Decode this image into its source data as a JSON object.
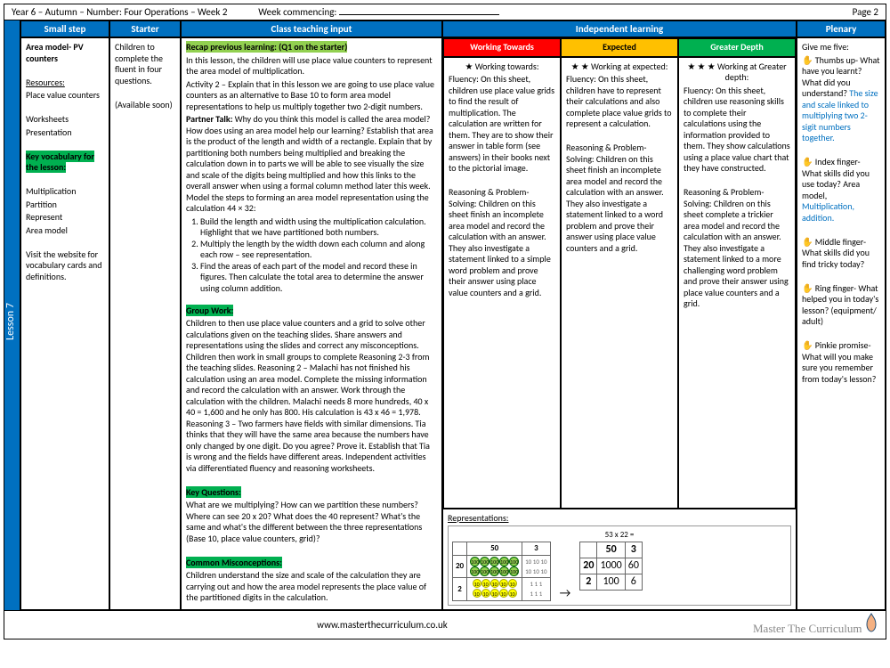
{
  "header": {
    "course": "Year 6 – Autumn – Number: Four Operations – Week 2",
    "week_label": "Week commencing:",
    "page": "Page 2"
  },
  "lesson_tab": "Lesson 7",
  "columns": {
    "smallstep": "Small step",
    "starter": "Starter",
    "teaching": "Class teaching input",
    "independent": "Independent learning",
    "plenary": "Plenary"
  },
  "smallstep": {
    "title": "Area model- PV counters",
    "resources_label": "Resources:",
    "resources": "Place value counters",
    "worksheets": "Worksheets",
    "presentation": "Presentation",
    "vocab_label": "Key vocabulary for the lesson:",
    "vocab1": "Multiplication",
    "vocab2": "Partition",
    "vocab3": "Represent",
    "vocab4": "Area model",
    "website": "Visit the website for vocabulary cards and definitions."
  },
  "starter": {
    "line1": "Children to complete the fluent in four questions.",
    "line2": "(Available soon)"
  },
  "teaching": {
    "recap_label": "Recap previous learning: (Q1 on the starter)",
    "intro": "In this lesson, the children will use place value counters to represent the area model of multiplication.",
    "activity2": "Activity 2 – Explain that in this lesson we are going to use place value counters as an alternative to Base 10 to form area model representations to help us multiply together two 2-digit numbers.",
    "partner_label": "Partner Talk:",
    "partner": "Why do you think this model is called the area model? How does using an area model help our learning? Establish that area is the product of the length and width of a rectangle. Explain that by partitioning both numbers being multiplied and breaking the calculation down in to parts we will be able to see visually the size and scale of the digits being multiplied and how this links to the overall answer when using a formal column method later this week. Model the steps to forming an area model representation using the calculation 44 × 32:",
    "step1": "Build the length and width using the multiplication calculation. Highlight that we have partitioned both numbers.",
    "step2": "Multiply the length by the width down each column and along each row – see representation.",
    "step3": "Find the areas of each part of the model and record these in figures. Then calculate the total area to determine the answer using column addition.",
    "group_label": "Group Work:",
    "group": "Children to then use place value counters and a grid to solve other calculations given on the teaching slides. Share answers and representations using the slides and correct any misconceptions. Children then work in small groups to complete Reasoning 2-3 from the teaching slides. Reasoning 2 – Malachi has not finished his calculation using an area model. Complete the missing information and record the calculation with an answer. Work through the calculation with the children. Malachi needs 8 more hundreds, 40 x 40 = 1,600 and he only has 800. His calculation is 43 x 46 = 1,978. Reasoning 3 – Two farmers have fields with similar dimensions. Tia thinks that they will have the same area because the numbers have only changed by one digit. Do you agree? Prove it. Establish that Tia is wrong and the fields have different areas. Independent activities via differentiated fluency and reasoning worksheets.",
    "keyq_label": "Key Questions:",
    "keyq": "What are we multiplying? How can we partition these numbers? Where can see 20 x 20? What does the 40 represent? What's the same and what's the different between the three representations (Base 10, place value counters, grid)?",
    "misc_label": "Common Misconceptions:",
    "misc": "Children understand the size and scale of the calculation they are carrying out and how the area model represents the place value of the partitioned digits in the calculation."
  },
  "bands": {
    "towards_header": "Working Towards",
    "expected_header": "Expected",
    "greater_header": "Greater Depth",
    "towards_title": "Working towards:",
    "towards_fluency": "Fluency: On this sheet, children use place value grids to find the result of multiplication. The calculation are written for them. They are to show their answer in table form (see answers) in their books next to the pictorial image.",
    "towards_rps": "Reasoning & Problem-Solving: Children on this sheet finish an incomplete area model and record the calculation with an answer. They also investigate a statement linked to a simple word problem and prove their answer using place value counters and a grid.",
    "expected_title": "Working at expected:",
    "expected_fluency": "Fluency: On this sheet, children have to represent their calculations and also complete place value grids to represent a calculation.",
    "expected_rps": "Reasoning & Problem-Solving: Children on this sheet finish an incomplete area model and record the calculation with an answer. They also investigate a statement linked to a word problem and prove their answer using place value counters and a grid.",
    "greater_title": "Working at Greater depth:",
    "greater_fluency": "Fluency: On this sheet, children use reasoning skills to complete their calculations using the information provided to them. They show calculations using a place value chart that they have constructed.",
    "greater_rps": "Reasoning & Problem-Solving: Children on this sheet complete a trickier area model and record the calculation with an answer. They also investigate a statement linked to a more challenging word problem and prove their answer using place value counters and a grid."
  },
  "representations": {
    "label": "Representations:",
    "calc": "53 x 22 =",
    "grid2": {
      "c50_r20": "1000",
      "c3_r20": "60",
      "c50_r2": "100",
      "c3_r2": "6"
    }
  },
  "plenary": {
    "title": "Give me five:",
    "thumbs": "Thumbs up- What have you learnt? What did you understand?",
    "thumbs_ans": "The size and scale linked to multiplying two 2-sigit numbers together.",
    "index": "Index finger- What skills did you use today? Area model,",
    "index_ans": "Multiplication, addition.",
    "middle": "Middle finger- What skills did you find tricky today?",
    "ring": "Ring finger- What helped you in today's lesson? (equipment/ adult)",
    "pinkie": "Pinkie promise- What will you make sure you remember from today's lesson?"
  },
  "footer": {
    "url": "www.masterthecurriculum.co.uk",
    "brand": "Master The Curriculum"
  },
  "chart_data": {
    "type": "table",
    "title": "Area model 53 × 22",
    "rows": [
      "20",
      "2"
    ],
    "columns": [
      "50",
      "3"
    ],
    "values": [
      [
        1000,
        60
      ],
      [
        100,
        6
      ]
    ]
  }
}
